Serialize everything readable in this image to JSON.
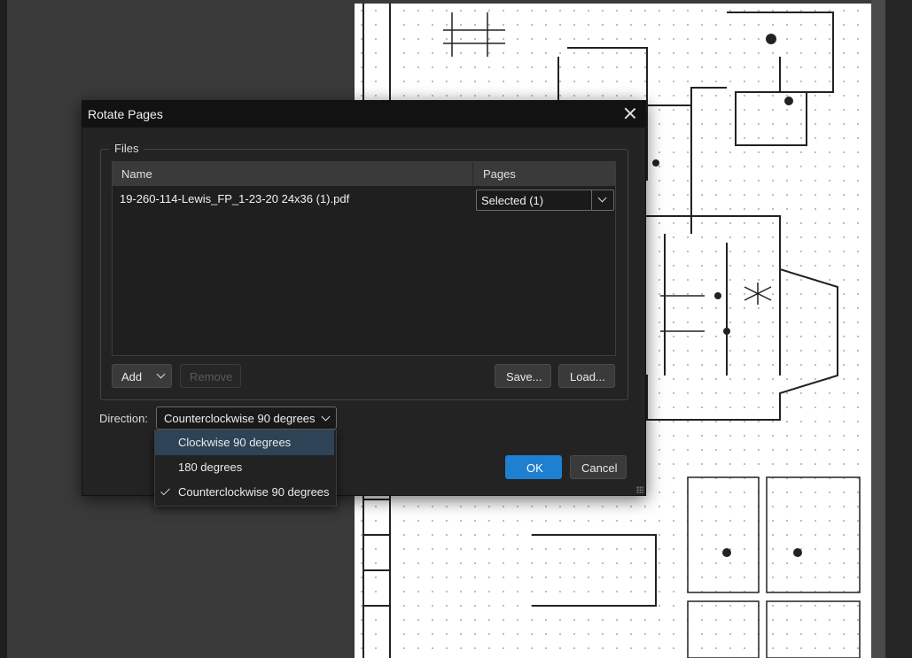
{
  "dialog": {
    "title": "Rotate Pages",
    "files_group_label": "Files",
    "columns": {
      "name": "Name",
      "pages": "Pages"
    },
    "files": [
      {
        "name": "19-260-114-Lewis_FP_1-23-20 24x36 (1).pdf",
        "pages": "Selected (1)"
      }
    ],
    "buttons": {
      "add": "Add",
      "remove": "Remove",
      "save": "Save...",
      "load": "Load...",
      "ok": "OK",
      "cancel": "Cancel"
    },
    "direction": {
      "label": "Direction:",
      "value": "Counterclockwise 90 degrees",
      "options": [
        "Clockwise 90 degrees",
        "180 degrees",
        "Counterclockwise 90 degrees"
      ],
      "hovered_index": 0,
      "selected_index": 2
    }
  },
  "colors": {
    "accent": "#1f7fd0",
    "dialog_bg": "#232323",
    "hover": "#2f4357"
  }
}
